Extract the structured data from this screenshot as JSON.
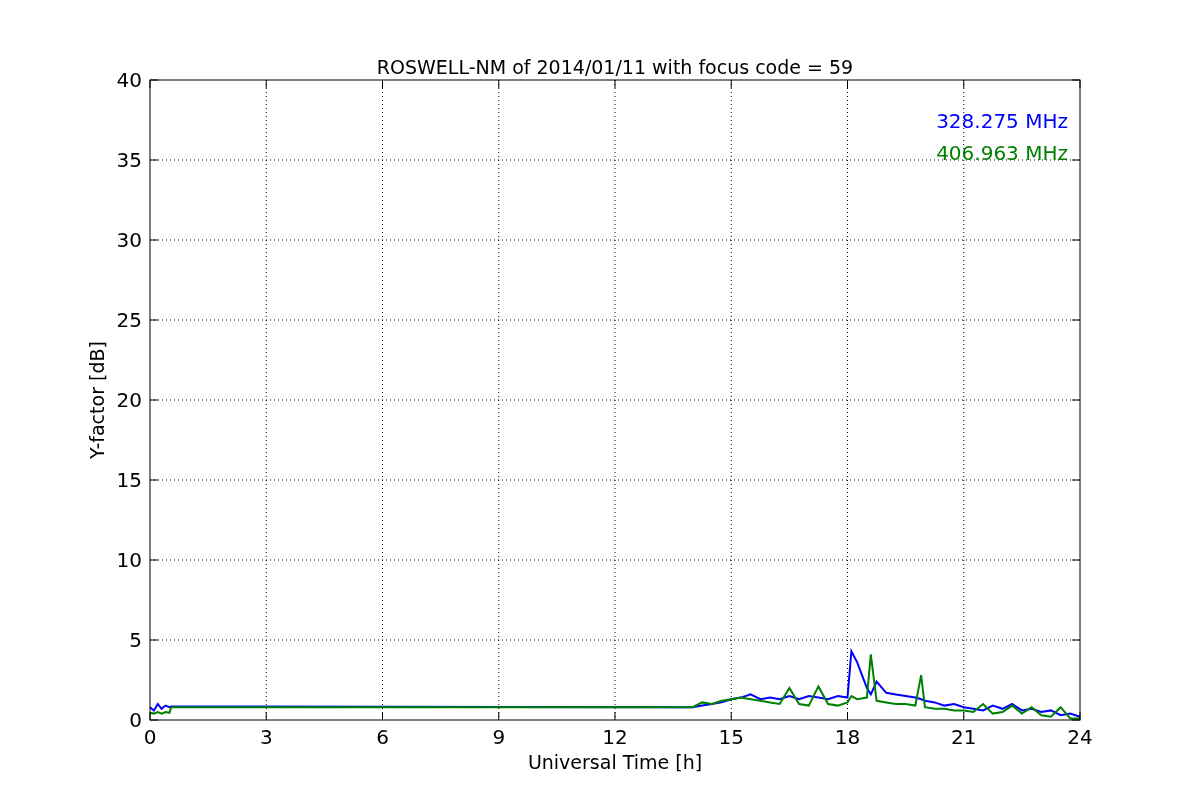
{
  "figure": {
    "chart_data": {
      "type": "line",
      "title": "ROSWELL-NM of 2014/01/11 with focus code = 59",
      "xlabel": "Universal Time [h]",
      "ylabel": "Y-factor [dB]",
      "x": [
        0,
        0.1,
        0.2,
        0.3,
        0.4,
        0.5,
        0.55,
        14,
        14.25,
        14.5,
        14.75,
        15,
        15.25,
        15.5,
        15.75,
        16,
        16.25,
        16.5,
        16.75,
        17,
        17.25,
        17.5,
        17.75,
        18,
        18.1,
        18.25,
        18.5,
        18.6,
        18.75,
        19,
        19.25,
        19.5,
        19.75,
        19.9,
        20,
        20.25,
        20.5,
        20.75,
        21,
        21.25,
        21.5,
        21.75,
        22,
        22.25,
        22.5,
        22.75,
        23,
        23.25,
        23.5,
        23.75,
        24
      ],
      "series": [
        {
          "name": "328.275 MHz",
          "color": "#0000ff",
          "values": [
            0.8,
            0.6,
            1.0,
            0.7,
            0.9,
            0.8,
            0.85,
            0.8,
            0.9,
            1.0,
            1.1,
            1.3,
            1.4,
            1.6,
            1.3,
            1.4,
            1.3,
            1.5,
            1.3,
            1.5,
            1.4,
            1.3,
            1.5,
            1.4,
            4.3,
            3.6,
            2.0,
            1.6,
            2.4,
            1.7,
            1.6,
            1.5,
            1.4,
            1.3,
            1.2,
            1.1,
            0.9,
            1.0,
            0.8,
            0.7,
            0.6,
            0.9,
            0.7,
            1.0,
            0.6,
            0.7,
            0.5,
            0.6,
            0.3,
            0.4,
            0.2
          ]
        },
        {
          "name": "406.963 MHz",
          "color": "#008000",
          "values": [
            0.45,
            0.4,
            0.5,
            0.4,
            0.5,
            0.45,
            0.8,
            0.8,
            1.1,
            1.0,
            1.2,
            1.3,
            1.4,
            1.3,
            1.2,
            1.1,
            1.0,
            2.0,
            1.0,
            0.9,
            2.1,
            1.0,
            0.9,
            1.1,
            1.5,
            1.3,
            1.4,
            4.1,
            1.2,
            1.1,
            1.0,
            1.0,
            0.9,
            2.8,
            0.8,
            0.7,
            0.7,
            0.6,
            0.6,
            0.5,
            1.0,
            0.4,
            0.5,
            0.9,
            0.4,
            0.8,
            0.3,
            0.2,
            0.8,
            0.1,
            0.1
          ]
        }
      ],
      "xlim": [
        0,
        24
      ],
      "ylim": [
        0,
        40
      ],
      "xticks": [
        0,
        3,
        6,
        9,
        12,
        15,
        18,
        21,
        24
      ],
      "yticks": [
        0,
        5,
        10,
        15,
        20,
        25,
        30,
        35,
        40
      ],
      "grid": true
    }
  }
}
